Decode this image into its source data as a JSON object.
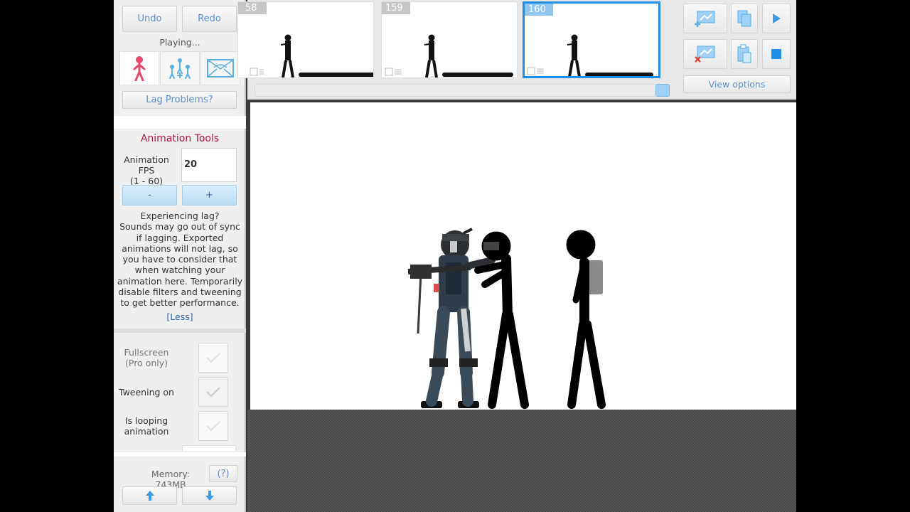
{
  "left_panel": {
    "undo_label": "Undo",
    "redo_label": "Redo",
    "status": "Playing...",
    "lag_button": "Lag Problems?",
    "section_title": "Animation Tools",
    "fps_label_line1": "Animation FPS",
    "fps_label_line2": "(1 - 60)",
    "fps_value": "20",
    "minus_label": "-",
    "plus_label": "+",
    "lag_help_title": "Experiencing lag?",
    "lag_help_body": "Sounds may go out of sync if lagging. Exported animations will not lag, so you have to consider that when watching your animation here. Temporarily disable filters and tweening to get better performance.",
    "less_link": "[Less]",
    "fullscreen_line1": "Fullscreen",
    "fullscreen_line2": "(Pro only)",
    "tweening_label": "Tweening on",
    "looping_line1": "Is looping",
    "looping_line2": "animation",
    "memory": "Memory: 743MB",
    "help_label": "(?)"
  },
  "timeline": {
    "frames": [
      {
        "number": "58"
      },
      {
        "number": "159"
      },
      {
        "number": "160"
      }
    ]
  },
  "right_tools": {
    "view_options": "View options"
  },
  "colors": {
    "accent": "#1e8ee6",
    "title_red": "#b0173a"
  }
}
